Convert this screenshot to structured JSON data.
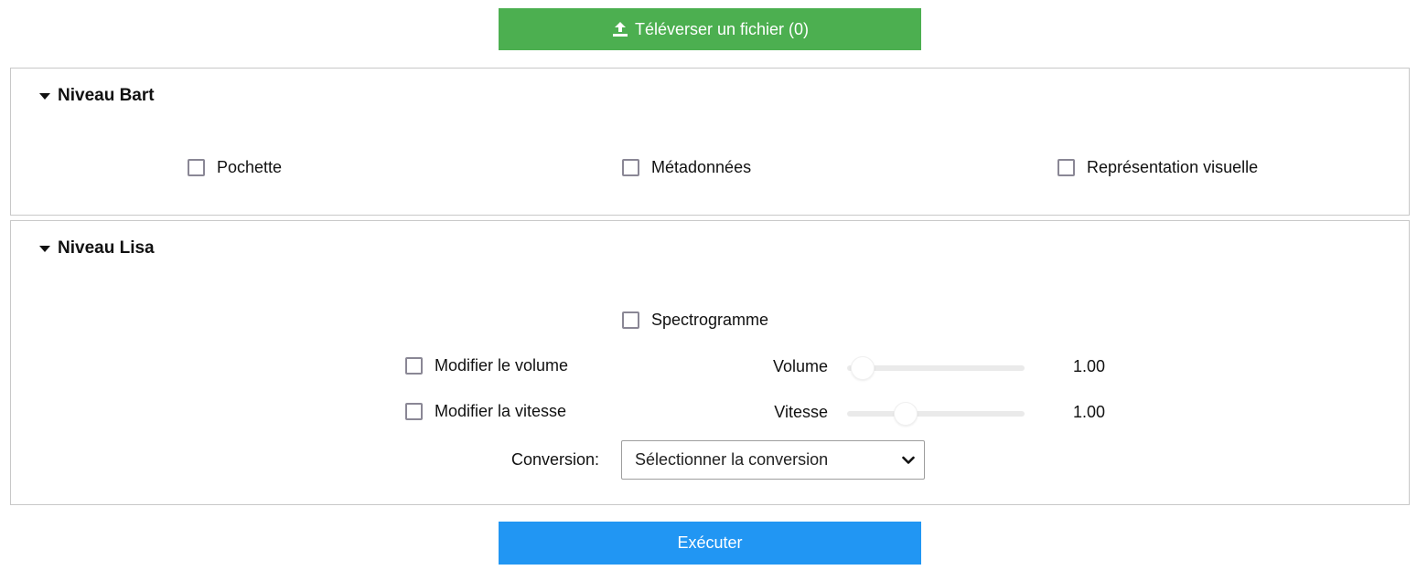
{
  "upload": {
    "label": "Téléverser un fichier (0)",
    "icon": "upload-icon"
  },
  "bart": {
    "title": "Niveau Bart",
    "options": [
      {
        "label": "Pochette",
        "checked": false
      },
      {
        "label": "Métadonnées",
        "checked": false
      },
      {
        "label": "Représentation visuelle",
        "checked": false
      }
    ]
  },
  "lisa": {
    "title": "Niveau Lisa",
    "spectrogram": {
      "label": "Spectrogramme",
      "checked": false
    },
    "volume": {
      "check_label": "Modifier le volume",
      "checked": false,
      "slider_label": "Volume",
      "value": "1.00"
    },
    "speed": {
      "check_label": "Modifier la vitesse",
      "checked": false,
      "slider_label": "Vitesse",
      "value": "1.00"
    },
    "conversion": {
      "label": "Conversion:",
      "selected": "Sélectionner la conversion"
    }
  },
  "execute": {
    "label": "Exécuter"
  },
  "colors": {
    "upload": "#4caf50",
    "execute": "#2196f3",
    "border": "#c8c8c8"
  }
}
